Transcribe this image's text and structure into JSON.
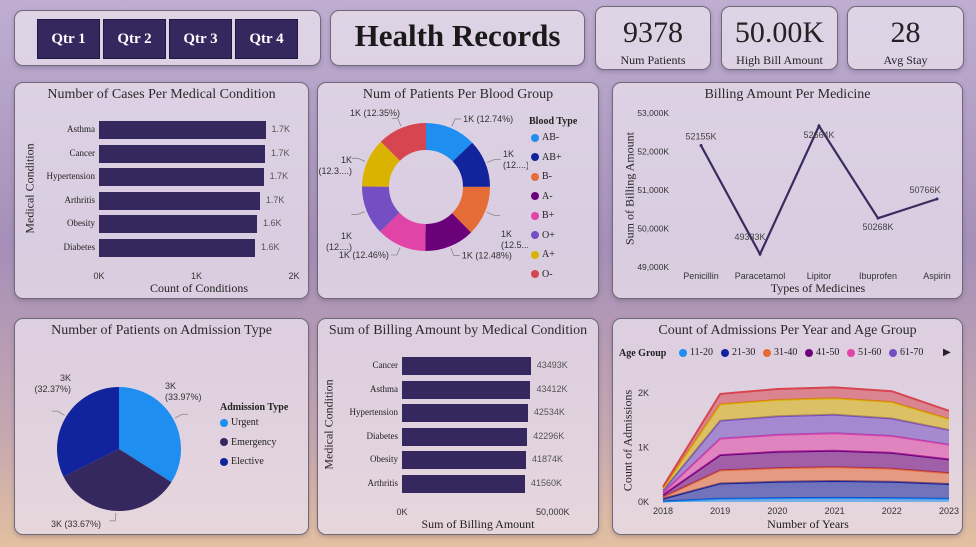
{
  "slicer": {
    "buttons": [
      "Qtr 1",
      "Qtr 2",
      "Qtr 3",
      "Qtr 4"
    ]
  },
  "header": {
    "title": "Health Records"
  },
  "kpis": [
    {
      "value": "9378",
      "label": "Num Patients"
    },
    {
      "value": "50.00K",
      "label": "High Bill Amount"
    },
    {
      "value": "28",
      "label": "Avg Stay"
    }
  ],
  "colors": {
    "bar": "#35285e",
    "line": "#3a2a5e"
  },
  "chart_data": [
    {
      "id": "cases_condition",
      "type": "bar",
      "title": "Number of Cases Per Medical Condition",
      "xlabel": "Count of Conditions",
      "ylabel": "Medical Condition",
      "categories": [
        "Asthma",
        "Cancer",
        "Hypertension",
        "Arthritis",
        "Obesity",
        "Diabetes"
      ],
      "values": [
        1708,
        1703,
        1688,
        1650,
        1620,
        1600
      ],
      "data_labels": [
        "1.7K",
        "1.7K",
        "1.7K",
        "1.7K",
        "1.6K",
        "1.6K"
      ],
      "xticks": [
        "0K",
        "1K",
        "2K"
      ],
      "xlim": [
        0,
        2000
      ]
    },
    {
      "id": "blood_group",
      "type": "pie",
      "title": "Num of Patients Per Blood Group",
      "legend_title": "Blood Type",
      "categories": [
        "AB-",
        "AB+",
        "B-",
        "A-",
        "B+",
        "O+",
        "A+",
        "O-"
      ],
      "values": [
        12.74,
        12.0,
        12.5,
        12.48,
        12.46,
        12.3,
        12.3,
        12.35
      ],
      "colors": [
        "#1f8ef1",
        "#12239e",
        "#e66c37",
        "#6b007b",
        "#e044a7",
        "#744ec2",
        "#d9b300",
        "#d64550"
      ],
      "data_labels": [
        "1K (12.74%)",
        "1K\n(12....)",
        "1K\n(12.5....)",
        "1K (12.48%)",
        "1K (12.46%)",
        "1K\n(12....)",
        "1K\n(12.3....)",
        "1K (12.35%)"
      ]
    },
    {
      "id": "billing_medicine",
      "type": "line",
      "title": "Billing Amount Per Medicine",
      "xlabel": "Types of Medicines",
      "ylabel": "Sum of Billing Amount",
      "categories": [
        "Penicillin",
        "Paracetamol",
        "Lipitor",
        "Ibuprofen",
        "Aspirin"
      ],
      "values": [
        52155,
        49333,
        52664,
        50268,
        50766
      ],
      "data_labels": [
        "52155K",
        "49333K",
        "52664K",
        "50268K",
        "50766K"
      ],
      "yticks": [
        "53,000K",
        "52,000K",
        "51,000K",
        "50,000K",
        "49,000K"
      ],
      "ylim": [
        49000,
        53000
      ]
    },
    {
      "id": "admission_type",
      "type": "pie",
      "title": "Number of Patients on Admission Type",
      "legend_title": "Admission Type",
      "categories": [
        "Urgent",
        "Emergency",
        "Elective"
      ],
      "values": [
        33.97,
        33.67,
        32.37
      ],
      "colors": [
        "#1f8ef1",
        "#35285e",
        "#12239e"
      ],
      "data_labels": [
        "3K\n(33.97%)",
        "3K (33.67%)",
        "3K\n(32.37%)"
      ]
    },
    {
      "id": "billing_condition",
      "type": "bar",
      "title": "Sum of Billing Amount by Medical Condition",
      "xlabel": "Sum of Billing Amount",
      "ylabel": "Medical Condition",
      "categories": [
        "Cancer",
        "Asthma",
        "Hypertension",
        "Diabetes",
        "Obesity",
        "Arthritis"
      ],
      "values": [
        43493,
        43412,
        42534,
        42296,
        41874,
        41560
      ],
      "data_labels": [
        "43493K",
        "43412K",
        "42534K",
        "42296K",
        "41874K",
        "41560K"
      ],
      "xticks": [
        "0K",
        "50,000K"
      ],
      "xlim": [
        0,
        50000
      ]
    },
    {
      "id": "admissions_age",
      "type": "area",
      "title": "Count of Admissions Per Year and Age Group",
      "xlabel": "Number of Years",
      "ylabel": "Count of Admissions",
      "legend_title": "Age Group",
      "x": [
        "2018",
        "2019",
        "2020",
        "2021",
        "2022",
        "2023"
      ],
      "yticks": [
        "2K",
        "1K",
        "0K"
      ],
      "ylim": [
        0,
        2400
      ],
      "series": [
        {
          "name": "11-20",
          "color": "#1f8ef1",
          "values": [
            10,
            60,
            70,
            75,
            70,
            60
          ]
        },
        {
          "name": "21-30",
          "color": "#12239e",
          "values": [
            50,
            280,
            300,
            310,
            300,
            270
          ]
        },
        {
          "name": "31-40",
          "color": "#e66c37",
          "values": [
            30,
            240,
            250,
            255,
            240,
            200
          ]
        },
        {
          "name": "41-50",
          "color": "#6b007b",
          "values": [
            40,
            280,
            300,
            300,
            290,
            250
          ]
        },
        {
          "name": "51-60",
          "color": "#e044a7",
          "values": [
            40,
            300,
            310,
            320,
            310,
            270
          ]
        },
        {
          "name": "61-70",
          "color": "#744ec2",
          "values": [
            40,
            330,
            340,
            340,
            320,
            270
          ]
        },
        {
          "name": "",
          "color": "#d9b300",
          "values": [
            40,
            300,
            300,
            300,
            300,
            200
          ]
        },
        {
          "name": "",
          "color": "#d64550",
          "values": [
            30,
            190,
            200,
            200,
            200,
            150
          ]
        }
      ]
    }
  ]
}
